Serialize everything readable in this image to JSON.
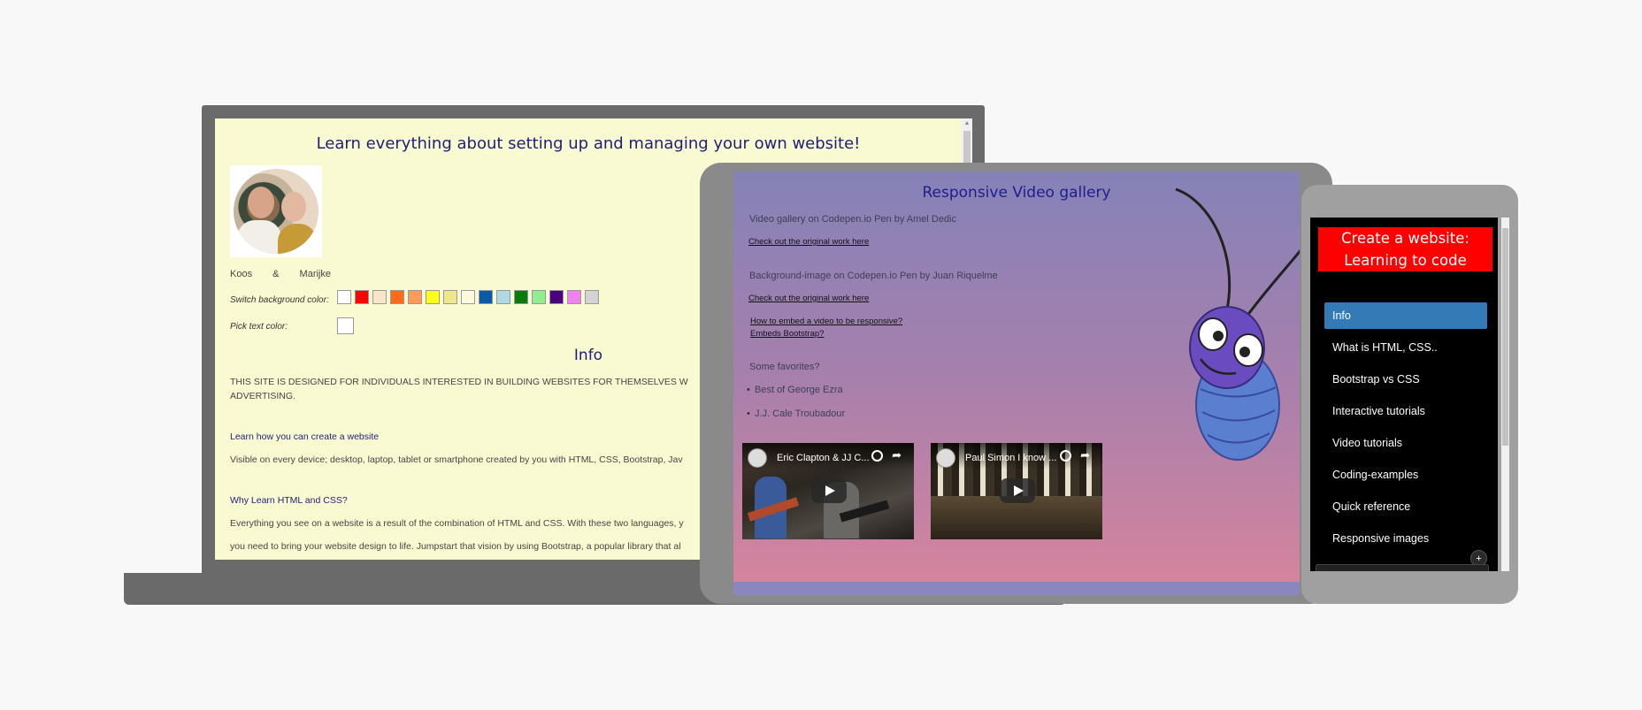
{
  "laptop": {
    "title": "Learn everything about setting up and managing your own website!",
    "names": [
      "Koos",
      "&",
      "Marijke"
    ],
    "switch_bg_label": "Switch background color:",
    "pick_text_label": "Pick text color:",
    "swatch_colors": [
      "#ffffff",
      "#ff0000",
      "#fbe4c8",
      "#ff6a1a",
      "#ff9a5a",
      "#ffff1a",
      "#f0e68c",
      "#fffae0",
      "#0a5aa8",
      "#add8e6",
      "#0a7a0a",
      "#90ee90",
      "#4b0082",
      "#ee82ee",
      "#d3d3d3"
    ],
    "info_heading": "Info",
    "intro_line1": "THIS SITE IS DESIGNED FOR INDIVIDUALS INTERESTED IN BUILDING WEBSITES FOR THEMSELVES W",
    "intro_line2": "ADVERTISING.",
    "link1": "Learn how you can create a website",
    "para1": "Visible on every device; desktop, laptop, tablet or smartphone created by you with HTML, CSS, Bootstrap, Jav",
    "link2": "Why Learn HTML and CSS?",
    "para2_line1": "Everything you see on a website is a result of the combination of HTML and CSS. With these two languages, y",
    "para2_line2": "you need to bring your website design to life. Jumpstart that vision by using Bootstrap, a popular library that al"
  },
  "tablet": {
    "title": "Responsive Video gallery",
    "gallery1": "Video gallery on Codepen.io Pen by Amel Dedic",
    "link_original1": "Check out the original work here",
    "gallery2": "Background-image on Codepen.io Pen by Juan Riquelme",
    "link_original2": "Check out the original work here",
    "link_embed": "How to embed a video to be responsive?",
    "link_bootstrap": "Embeds Bootstrap?",
    "favorites": "Some favorites?",
    "bullets": [
      "Best of George Ezra",
      "J.J. Cale Troubadour"
    ],
    "videos": [
      {
        "title": "Eric Clapton & JJ C..."
      },
      {
        "title": "Paul Simon I know ..."
      }
    ]
  },
  "phone": {
    "header": [
      "Create a website:",
      "Learning to code"
    ],
    "nav": [
      {
        "label": "Info",
        "active": true
      },
      {
        "label": "What is HTML, CSS.."
      },
      {
        "label": "Bootstrap vs CSS"
      },
      {
        "label": "Interactive tutorials"
      },
      {
        "label": "Video tutorials"
      },
      {
        "label": "Coding-examples"
      },
      {
        "label": "Quick reference"
      },
      {
        "label": "Responsive images"
      }
    ],
    "plus": "+"
  }
}
